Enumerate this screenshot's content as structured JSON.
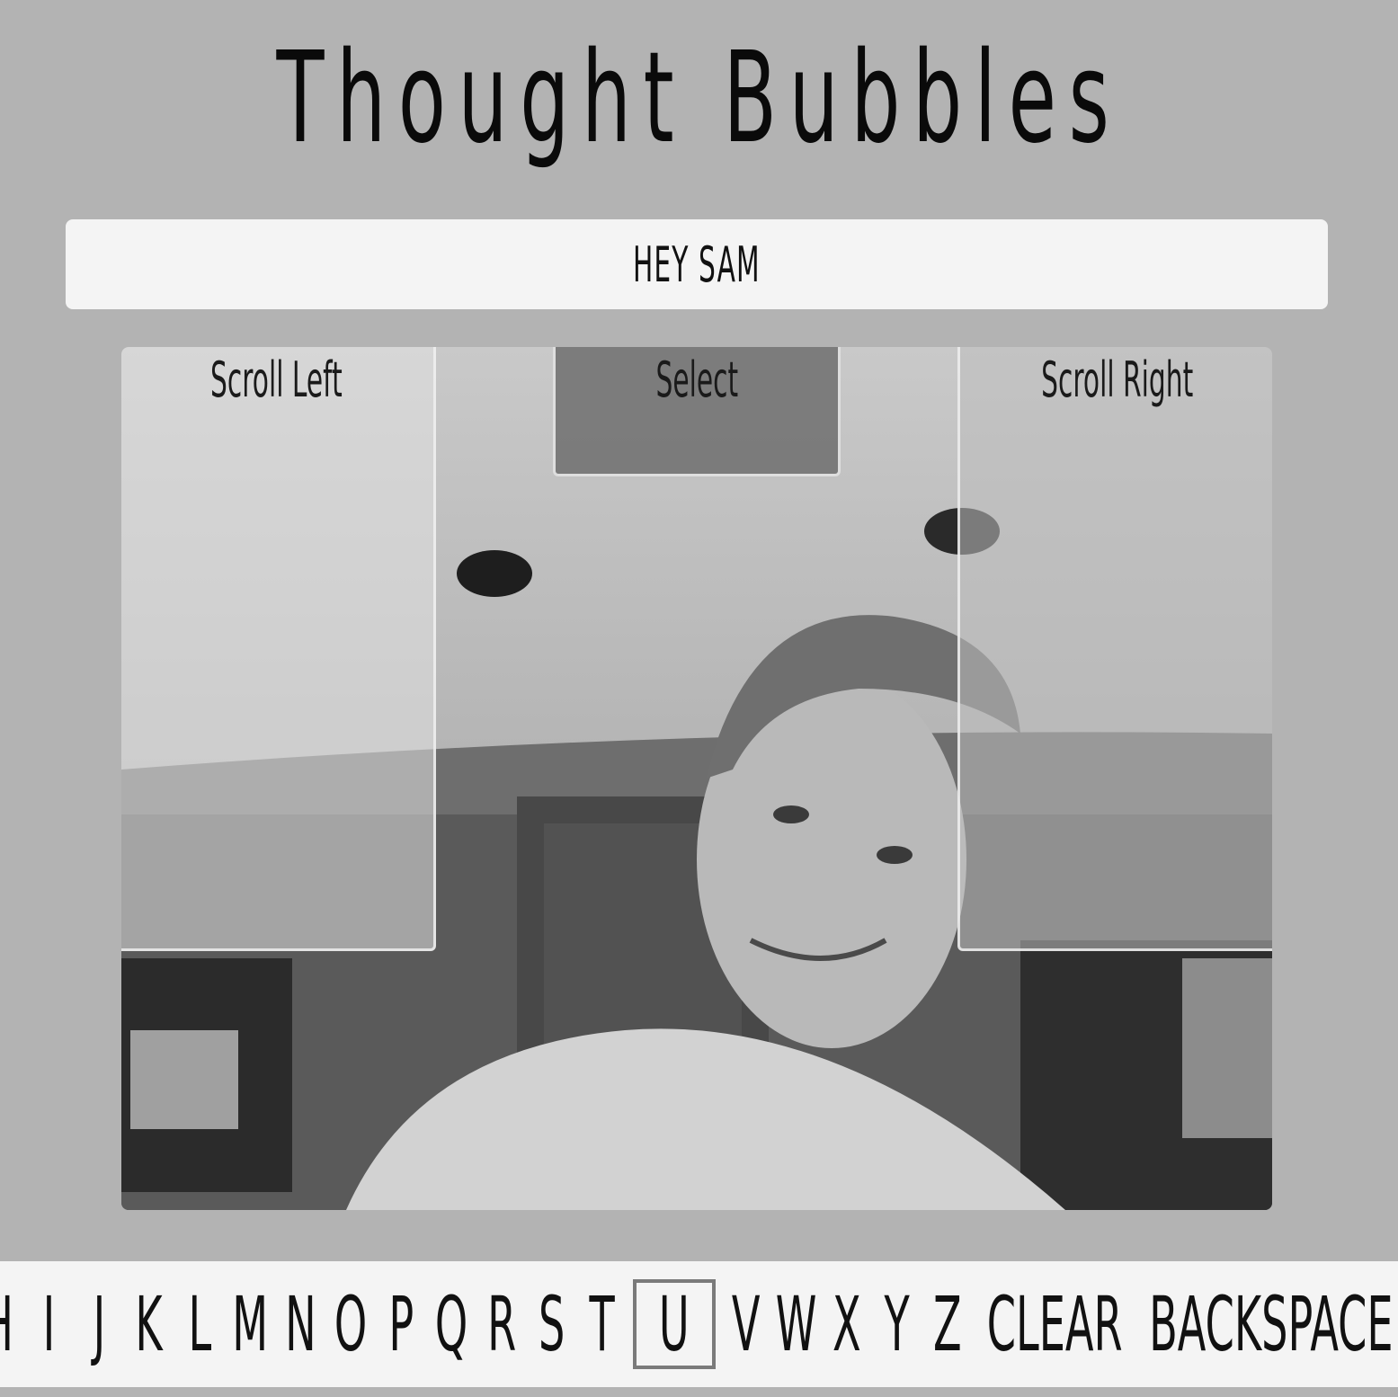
{
  "app": {
    "title": "Thought Bubbles"
  },
  "message": {
    "text": "HEY SAM"
  },
  "zones": {
    "scroll_left": "Scroll Left",
    "select": "Select",
    "scroll_right": "Scroll Right"
  },
  "keyboard": {
    "keys": [
      "H",
      "I",
      "J",
      "K",
      "L",
      "M",
      "N",
      "O",
      "P",
      "Q",
      "R",
      "S",
      "T",
      "U",
      "V",
      "W",
      "X",
      "Y",
      "Z",
      "CLEAR",
      "BACKSPACE"
    ],
    "selected": "U"
  },
  "colors": {
    "background": "#b3b3b3",
    "panel": "#f4f4f4",
    "text": "#111111",
    "selected_border": "#7a7a7a"
  }
}
